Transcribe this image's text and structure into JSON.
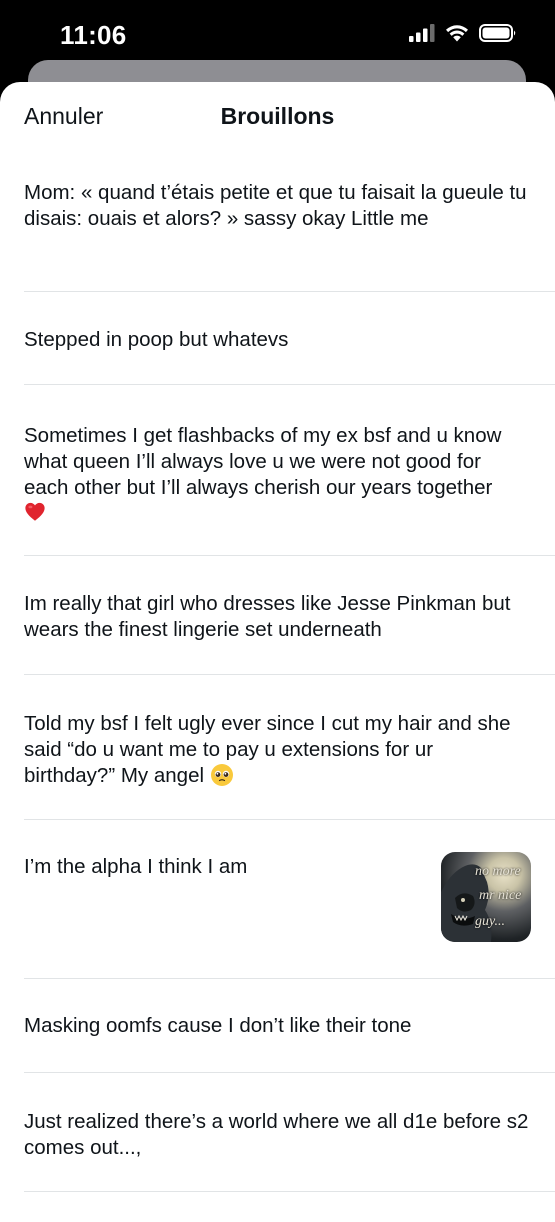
{
  "status_bar": {
    "time": "11:06",
    "icons": [
      "signal-icon",
      "wifi-icon",
      "battery-icon"
    ]
  },
  "header": {
    "cancel_label": "Annuler",
    "title": "Brouillons"
  },
  "drafts": [
    {
      "text": "Mom: « quand t’étais petite et que tu faisait la gueule tu disais: ouais et alors? » sassy okay Little me"
    },
    {
      "text": "Stepped in poop but whatevs"
    },
    {
      "text": "Sometimes I get flashbacks of my ex bsf and u know what queen I’ll always love u we were not good for each other but I’ll always cherish our years together",
      "emoji": "red-heart-emoji"
    },
    {
      "text": "Im really that girl who dresses like Jesse Pinkman but wears the finest lingerie set underneath"
    },
    {
      "text": "Told my bsf I felt ugly ever since I cut my hair and she said “do u want me to pay u extensions for ur birthday?” My angel",
      "emoji": "pleading-face-emoji"
    },
    {
      "text": "I’m the alpha I think I am",
      "thumbnail_text": [
        "no more",
        "mr nice",
        "guy..."
      ]
    },
    {
      "text": "Masking oomfs cause I don’t like their tone"
    },
    {
      "text": "Just realized there’s a world where we all d1e before s2 comes out...,"
    }
  ],
  "colors": {
    "text": "#0f1419",
    "divider": "#e1e4e6",
    "background": "#ffffff",
    "status_bar": "#000000"
  }
}
